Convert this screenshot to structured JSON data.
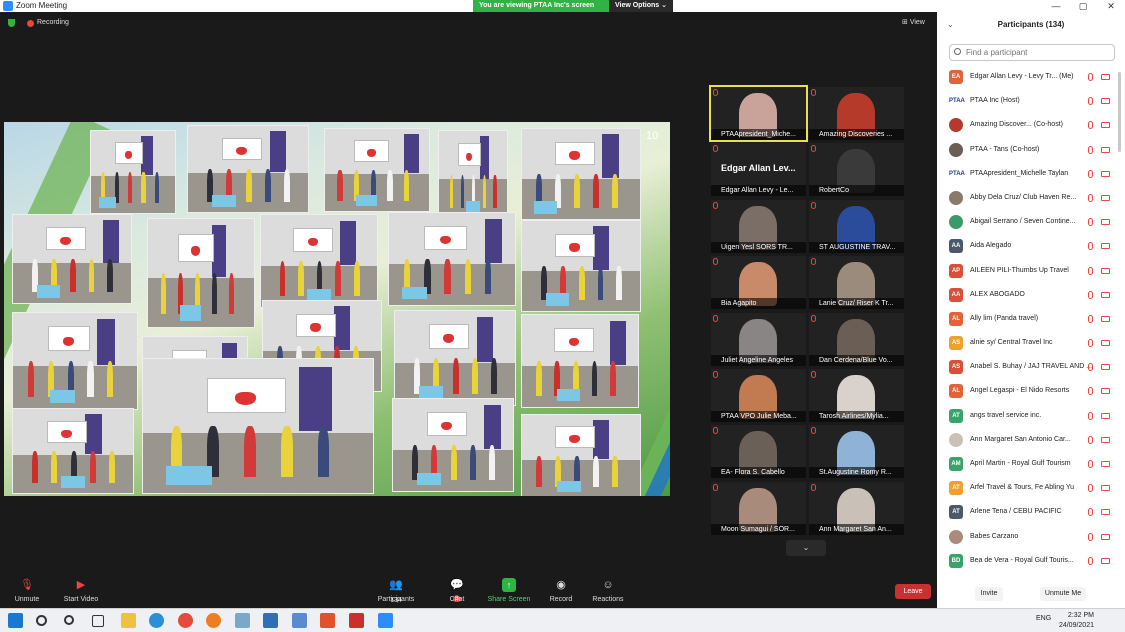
{
  "window": {
    "title": "Zoom Meeting",
    "min": "—",
    "max": "▢",
    "close": "✕"
  },
  "banner": {
    "viewing": "You are viewing PTAA Inc's screen",
    "view_options": "View Options ⌄"
  },
  "meeting": {
    "recording": "Recording",
    "view": "View"
  },
  "share": {
    "page_number": "10"
  },
  "gallery": [
    {
      "name": "PTAApresident_Miche...",
      "active": true,
      "color": "#c9a39a"
    },
    {
      "name": "Amazing Discoveries ...",
      "color": "#b63a2a"
    },
    {
      "name": "Edgar Allan Levy - Le...",
      "big": "Edgar Allan Lev...",
      "color": "#1f1f1f"
    },
    {
      "name": "RobertCo",
      "color": "#3a3a3a"
    },
    {
      "name": "Uigen Yesl SORS TR...",
      "color": "#7a6e66"
    },
    {
      "name": "ST AUGUSTINE TRAV...",
      "color": "#2a4c9a"
    },
    {
      "name": "Bia Agapito",
      "color": "#c98a6a"
    },
    {
      "name": "Lanie Cruz/ Riser K Tr...",
      "color": "#9b8b7c"
    },
    {
      "name": "Juliet Angeline Angeles",
      "color": "#8a8585"
    },
    {
      "name": "Dan Cerdena/Blue Vo...",
      "color": "#6b5e55"
    },
    {
      "name": "PTAA VPO Julie Meba...",
      "color": "#c27a50"
    },
    {
      "name": "Tarosh Airlines/Mylia...",
      "color": "#d9d2cc"
    },
    {
      "name": "EA- Flora S. Cabello",
      "color": "#6a6058"
    },
    {
      "name": "St.Augustine Romy R...",
      "color": "#8fb3d6"
    },
    {
      "name": "Moon Sumagui / SOR...",
      "color": "#a88b7a"
    },
    {
      "name": "Ann Margaret San An...",
      "color": "#c9c1b8"
    }
  ],
  "toolbar": {
    "unmute": "Unmute",
    "start_video": "Start Video",
    "participants": "Participants",
    "participants_count": "134",
    "chat": "Chat",
    "chat_badge": "3",
    "share_screen": "Share Screen",
    "record": "Record",
    "reactions": "Reactions",
    "leave": "Leave"
  },
  "panel": {
    "title": "Participants (134)",
    "search_placeholder": "Find a participant",
    "invite": "Invite",
    "unmute_me": "Unmute Me",
    "participants": [
      {
        "initials": "EA",
        "name": "Edgar Allan Levy - Levy Tr...",
        "role": "(Me)",
        "color": "#e0633a"
      },
      {
        "initials": "PTAA",
        "name": "PTAA Inc (Host)",
        "role": "",
        "color": "#ffffff"
      },
      {
        "initials": "",
        "name": "Amazing Discover... (Co-host)",
        "role": "",
        "color": "#b63a2a"
      },
      {
        "initials": "",
        "name": "PTAA - Tans (Co-host)",
        "role": "",
        "color": "#6b5e55"
      },
      {
        "initials": "PTAA",
        "name": "PTAApresident_Michelle Taylan",
        "role": "",
        "color": "#ffffff"
      },
      {
        "initials": "",
        "name": "Abby Dela Cruz/ Club Haven Re...",
        "role": "",
        "color": "#8a7a6c"
      },
      {
        "initials": "",
        "name": "Abigail Serrano / Seven Contine...",
        "role": "",
        "color": "#3a9a6a"
      },
      {
        "initials": "AA",
        "name": "Aida Alegado",
        "role": "",
        "color": "#4a5a6a"
      },
      {
        "initials": "AP",
        "name": "AILEEN PILI-Thumbs Up Travel",
        "role": "",
        "color": "#d9503a"
      },
      {
        "initials": "AA",
        "name": "ALEX ABOGADO",
        "role": "",
        "color": "#d9503a"
      },
      {
        "initials": "AL",
        "name": "Ally lim  (Panda travel)",
        "role": "",
        "color": "#e0633a"
      },
      {
        "initials": "AS",
        "name": "alnie sy/ Central Travel Inc",
        "role": "",
        "color": "#f0a030"
      },
      {
        "initials": "AS",
        "name": "Anabel S. Buhay / JAJ TRAVEL AND ...",
        "role": "",
        "color": "#d9503a"
      },
      {
        "initials": "AL",
        "name": "Angel Legaspi - El Nido Resorts",
        "role": "",
        "color": "#e0633a"
      },
      {
        "initials": "AT",
        "name": "angs travel service inc.",
        "role": "",
        "color": "#3aa36a"
      },
      {
        "initials": "",
        "name": "Ann Margaret San Antonio Car...",
        "role": "",
        "color": "#c9c1b8"
      },
      {
        "initials": "AM",
        "name": "April Martin - Royal Gulf Tourism",
        "role": "",
        "color": "#3aa36a"
      },
      {
        "initials": "AT",
        "name": "Arfel Travel & Tours, Fe Abling Yu",
        "role": "",
        "color": "#f0a030"
      },
      {
        "initials": "AT",
        "name": "Arlene Tena / CEBU PACIFIC",
        "role": "",
        "color": "#4a5a6a"
      },
      {
        "initials": "",
        "name": "Babes Carzano",
        "role": "",
        "color": "#a88b7a"
      },
      {
        "initials": "BD",
        "name": "Bea de Vera - Royal Gulf Touris...",
        "role": "",
        "color": "#3aa36a"
      }
    ]
  },
  "taskbar": {
    "time": "2:32 PM",
    "date": "24/09/2021",
    "lang": "ENG"
  },
  "colors": {
    "accent": "#2d8cff",
    "leave": "#c93131",
    "share_green": "#2fb342"
  }
}
